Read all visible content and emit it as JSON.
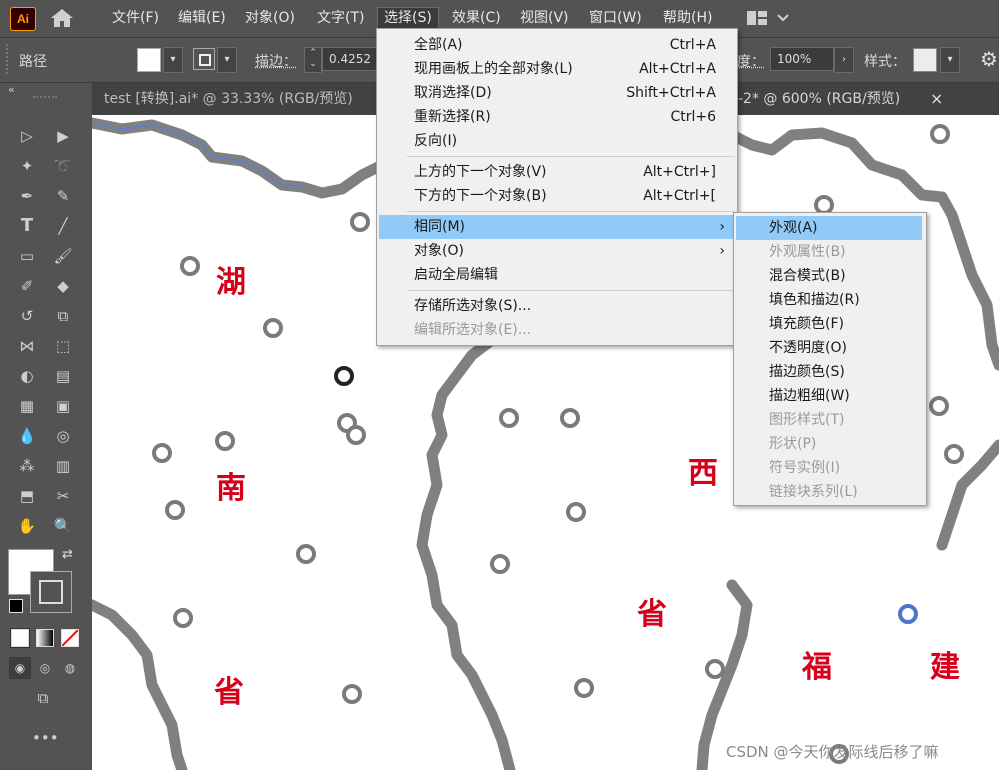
{
  "app": {
    "logo": "Ai"
  },
  "menubar": {
    "items": [
      "文件(F)",
      "编辑(E)",
      "对象(O)",
      "文字(T)",
      "选择(S)",
      "效果(C)",
      "视图(V)",
      "窗口(W)",
      "帮助(H)"
    ]
  },
  "controlbar": {
    "selection_type": "路径",
    "stroke_label": "描边：",
    "stroke_value": "0.4252",
    "opacity_label": "度：",
    "opacity_value": "100%",
    "style_label": "样式："
  },
  "tabs": {
    "tab1": "test [转换].ai* @ 33.33% (RGB/预览)",
    "tab2": "-2* @ 600% (RGB/预览)",
    "close": "×"
  },
  "select_menu": {
    "items": [
      {
        "label": "全部(A)",
        "shortcut": "Ctrl+A"
      },
      {
        "label": "现用画板上的全部对象(L)",
        "shortcut": "Alt+Ctrl+A"
      },
      {
        "label": "取消选择(D)",
        "shortcut": "Shift+Ctrl+A"
      },
      {
        "label": "重新选择(R)",
        "shortcut": "Ctrl+6"
      },
      {
        "label": "反向(I)",
        "shortcut": ""
      },
      {
        "label": "上方的下一个对象(V)",
        "shortcut": "Alt+Ctrl+]"
      },
      {
        "label": "下方的下一个对象(B)",
        "shortcut": "Alt+Ctrl+["
      },
      {
        "label": "相同(M)",
        "shortcut": "›"
      },
      {
        "label": "对象(O)",
        "shortcut": "›"
      },
      {
        "label": "启动全局编辑",
        "shortcut": ""
      },
      {
        "label": "存储所选对象(S)...",
        "shortcut": ""
      },
      {
        "label": "编辑所选对象(E)...",
        "shortcut": ""
      }
    ]
  },
  "same_submenu": {
    "items": [
      "外观(A)",
      "外观属性(B)",
      "混合模式(B)",
      "填色和描边(R)",
      "填充颜色(F)",
      "不透明度(O)",
      "描边颜色(S)",
      "描边粗细(W)",
      "图形样式(T)",
      "形状(P)",
      "符号实例(I)",
      "链接块系列(L)"
    ]
  },
  "canvas": {
    "labels": [
      "湖",
      "南",
      "省",
      "西",
      "省",
      "福",
      "建"
    ]
  },
  "watermark": "CSDN @今天你发际线后移了嘛"
}
